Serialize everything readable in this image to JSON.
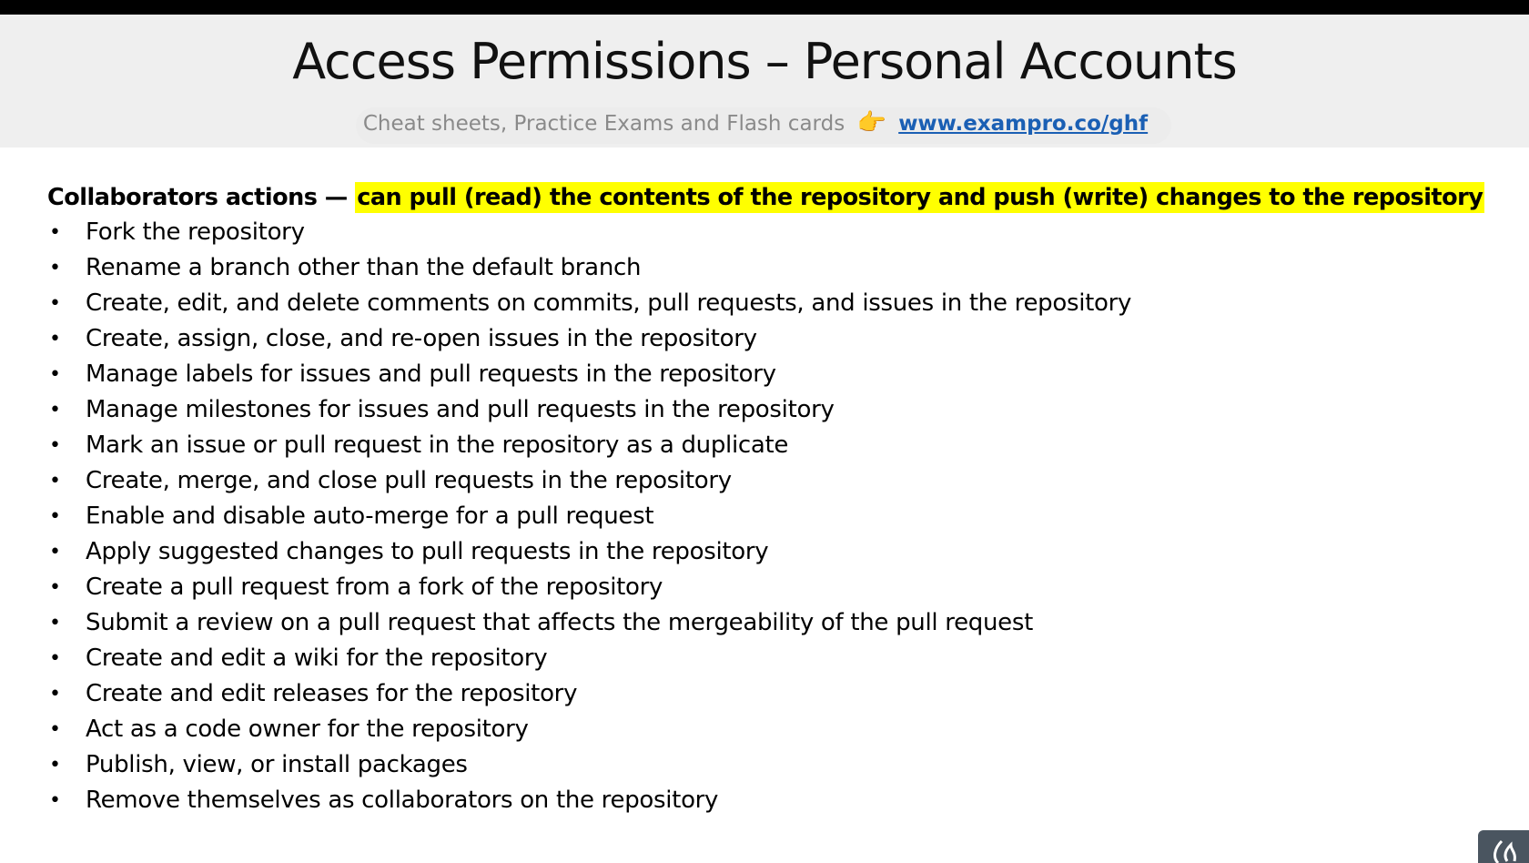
{
  "header": {
    "title": "Access Permissions – Personal Accounts",
    "subtitle_text": "Cheat sheets, Practice Exams and Flash cards",
    "pointer_icon": "👉",
    "link_text": "www.exampro.co/ghf"
  },
  "content": {
    "heading_prefix": "Collaborators actions —",
    "heading_highlight": "can pull (read) the contents of the repository and push (write) changes to the repository",
    "highlight_color": "#ffff00",
    "items": [
      "Fork the repository",
      "Rename a branch other than the default branch",
      "Create, edit, and delete comments on commits, pull requests, and issues in the repository",
      "Create, assign, close, and re-open issues in the repository",
      "Manage labels for issues and pull requests in the repository",
      "Manage milestones for issues and pull requests in the repository",
      "Mark an issue or pull request in the repository as a duplicate",
      "Create, merge, and close pull requests in the repository",
      "Enable and disable auto-merge for a pull request",
      "Apply suggested changes to pull requests in the repository",
      "Create a pull request from a fork of the repository",
      "Submit a review on a pull request that affects the mergeability of the pull request",
      "Create and edit a wiki for the repository",
      "Create and edit releases for the repository",
      "Act as a code owner for the repository",
      "Publish, view, or install packages",
      "Remove themselves as collaborators on the repository"
    ]
  },
  "icons": {
    "bullet": "•",
    "logo": "flame-logo-icon"
  }
}
